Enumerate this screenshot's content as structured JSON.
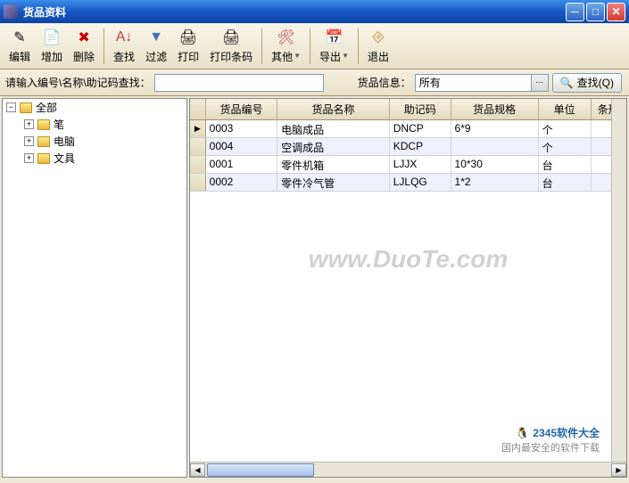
{
  "window": {
    "title": "货品资料"
  },
  "toolbar": {
    "edit": "编辑",
    "add": "增加",
    "del": "删除",
    "find": "查找",
    "filter": "过滤",
    "print": "打印",
    "barcode": "打印条码",
    "other": "其他",
    "export": "导出",
    "exit": "退出"
  },
  "search": {
    "label": "请输入编号\\名称\\助记码查找：",
    "value": "",
    "info_label": "货品信息：",
    "combo_value": "所有",
    "button": "查找(Q)"
  },
  "tree": {
    "root": "全部",
    "children": [
      "笔",
      "电脑",
      "文具"
    ]
  },
  "grid": {
    "columns": [
      "货品编号",
      "货品名称",
      "助记码",
      "货品规格",
      "单位",
      "条形"
    ],
    "rows": [
      {
        "no": "0003",
        "name": "电脑成品",
        "code": "DNCP",
        "spec": "6*9",
        "unit": "个"
      },
      {
        "no": "0004",
        "name": "空调成品",
        "code": "KDCP",
        "spec": "",
        "unit": "个"
      },
      {
        "no": "0001",
        "name": "零件机箱",
        "code": "LJJX",
        "spec": "10*30",
        "unit": "台"
      },
      {
        "no": "0002",
        "name": "零件冷气管",
        "code": "LJLQG",
        "spec": "1*2",
        "unit": "台"
      }
    ]
  },
  "watermark": "www.DuoTe.com",
  "brand": {
    "name": "2345软件大全",
    "slogan": "国内最安全的软件下载"
  }
}
